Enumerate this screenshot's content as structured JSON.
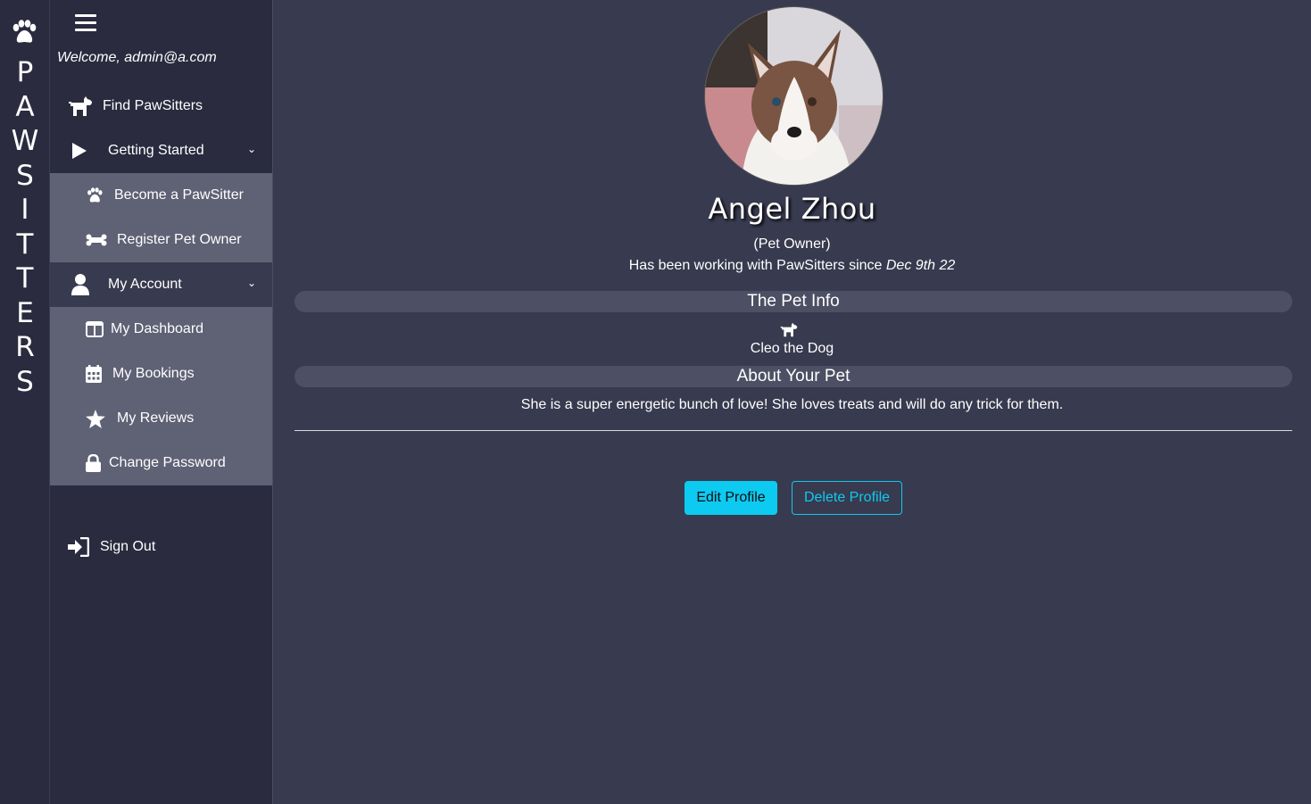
{
  "brand": {
    "letters": [
      "P",
      "A",
      "W",
      "S",
      "I",
      "T",
      "T",
      "E",
      "R",
      "S"
    ],
    "logo_icon": "paw-icon"
  },
  "sidebar": {
    "menu_icon": "hamburger-icon",
    "welcome": "Welcome, admin@a.com",
    "find": {
      "label": "Find PawSitters",
      "icon": "dog-icon"
    },
    "getting_started": {
      "label": "Getting Started",
      "icon": "play-icon",
      "items": [
        {
          "label": "Become a PawSitter",
          "icon": "paw-icon"
        },
        {
          "label": "Register Pet Owner",
          "icon": "bone-icon"
        }
      ]
    },
    "my_account": {
      "label": "My Account",
      "icon": "user-icon",
      "items": [
        {
          "label": "My Dashboard",
          "icon": "dashboard-icon"
        },
        {
          "label": "My Bookings",
          "icon": "calendar-icon"
        },
        {
          "label": "My Reviews",
          "icon": "star-icon"
        },
        {
          "label": "Change Password",
          "icon": "lock-icon"
        }
      ]
    },
    "sign_out": {
      "label": "Sign Out",
      "icon": "sign-in-icon"
    }
  },
  "profile": {
    "name": "Angel Zhou",
    "role": "(Pet Owner)",
    "since_prefix": "Has been working with PawSitters since ",
    "since_date": "Dec 9th 22",
    "pet_info_heading": "The Pet Info",
    "pet_icon": "dog-icon",
    "pet_name": "Cleo the Dog",
    "about_heading": "About Your Pet",
    "about_text": "She is a super energetic bunch of love! She loves treats and will do any trick for them.",
    "edit_label": "Edit Profile",
    "delete_label": "Delete Profile"
  },
  "colors": {
    "background": "#383a4f",
    "sidebar": "#2a2b3f",
    "submenu": "#5f6175",
    "accent": "#0dcaf0"
  }
}
